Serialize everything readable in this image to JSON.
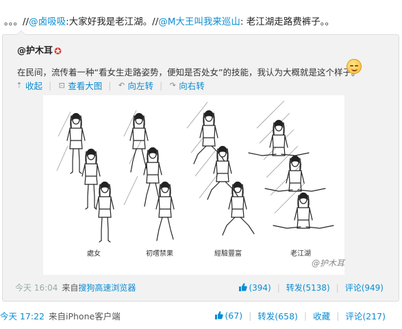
{
  "post": {
    "prefix": "。。。//",
    "mention1": "@卤吸吸",
    "text1": ":大家好我是老江湖。//",
    "mention2": "@M大王叫我来巡山",
    "text2": ": 老江湖走路费裤子。。"
  },
  "repost": {
    "author": "@护木耳",
    "text": "在民间，流传着一种“看女生走路姿势，便知是否处女”的技能，我认为大概就是这个样子。",
    "actions": {
      "collapse": "收起",
      "view_large": "查看大图",
      "rotate_left": "向左转",
      "rotate_right": "向右转"
    },
    "image": {
      "captions": [
        "處女",
        "初嚐禁果",
        "經驗豐富",
        "老江湖"
      ],
      "watermark": "@护木耳"
    },
    "meta": {
      "time": "今天 16:04",
      "from_prefix": "来自",
      "from_app": "搜狗高速浏览器",
      "likes": "(394)",
      "repost": "转发(5138)",
      "comment": "评论(949)"
    }
  },
  "outer_meta": {
    "time": "今天 17:22",
    "from": "来自iPhone客户端",
    "likes": "(67)",
    "repost": "转发(658)",
    "favorite": "收藏",
    "comment": "评论(217)"
  },
  "colors": {
    "link": "#0a8cd2",
    "box_bg": "#f2f2f2",
    "badge": "#e0332e"
  }
}
